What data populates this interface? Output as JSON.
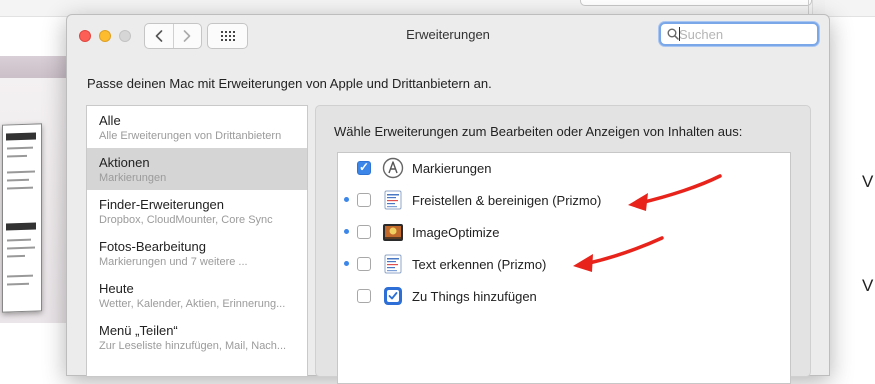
{
  "window": {
    "title": "Erweiterungen",
    "search_placeholder": "Suchen"
  },
  "intro_text": "Passe deinen Mac mit Erweiterungen von Apple und Drittanbietern an.",
  "sidebar": {
    "items": [
      {
        "title": "Alle",
        "subtitle": "Alle Erweiterungen von Drittanbietern",
        "selected": false
      },
      {
        "title": "Aktionen",
        "subtitle": "Markierungen",
        "selected": true
      },
      {
        "title": "Finder-Erweiterungen",
        "subtitle": "Dropbox, CloudMounter, Core Sync",
        "selected": false
      },
      {
        "title": "Fotos-Bearbeitung",
        "subtitle": "Markierungen und 7 weitere ...",
        "selected": false
      },
      {
        "title": "Heute",
        "subtitle": "Wetter, Kalender, Aktien, Erinnerung...",
        "selected": false
      },
      {
        "title": "Menü „Teilen“",
        "subtitle": "Zur Leseliste hinzufügen, Mail, Nach...",
        "selected": false
      }
    ]
  },
  "panel": {
    "heading": "Wähle Erweiterungen zum Bearbeiten oder Anzeigen von Inhalten aus:",
    "extensions": [
      {
        "label": "Markierungen",
        "checked": true,
        "new_dot": false,
        "icon": "markup-icon"
      },
      {
        "label": "Freistellen & bereinigen (Prizmo)",
        "checked": false,
        "new_dot": true,
        "icon": "prizmo-icon"
      },
      {
        "label": "ImageOptimize",
        "checked": false,
        "new_dot": true,
        "icon": "imageoptimize-icon"
      },
      {
        "label": "Text erkennen (Prizmo)",
        "checked": false,
        "new_dot": true,
        "icon": "prizmo-icon"
      },
      {
        "label": "Zu Things hinzufügen",
        "checked": false,
        "new_dot": false,
        "icon": "things-icon"
      }
    ]
  },
  "background": {
    "right_letters": [
      "V",
      "V"
    ]
  },
  "colors": {
    "accent": "#3b86e8",
    "annotation_arrow": "#e8231b",
    "selected_row": "#d5d5d5"
  }
}
